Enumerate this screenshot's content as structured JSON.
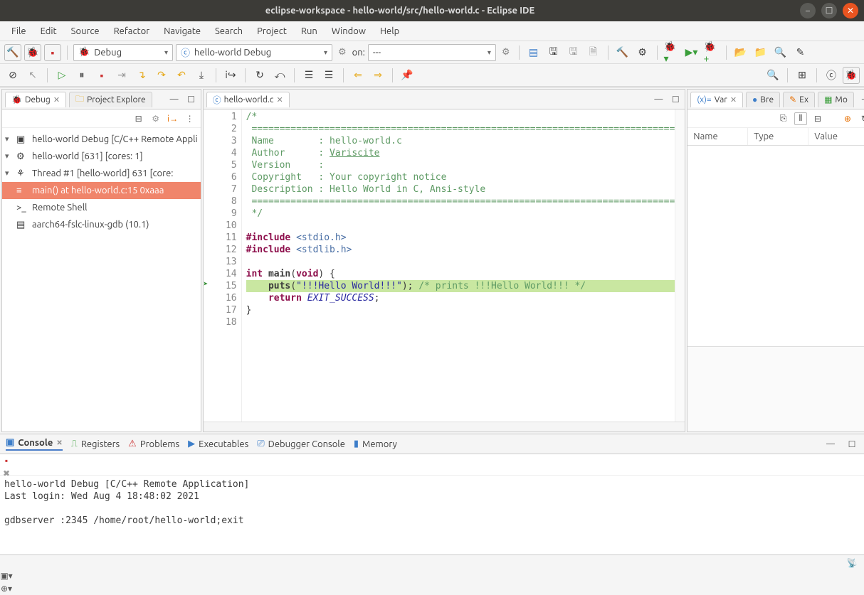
{
  "window": {
    "title": "eclipse-workspace - hello-world/src/hello-world.c - Eclipse IDE"
  },
  "menu": [
    "File",
    "Edit",
    "Source",
    "Refactor",
    "Navigate",
    "Search",
    "Project",
    "Run",
    "Window",
    "Help"
  ],
  "run_config": {
    "mode": "Debug",
    "launch": "hello-world Debug",
    "on_label": "on:",
    "on_value": "---"
  },
  "debug_view": {
    "tab_debug": "Debug",
    "tab_project_explorer": "Project Explore",
    "tree": [
      {
        "indent": 0,
        "twisty": "▾",
        "icon": "launch-icon",
        "label": "hello-world Debug [C/C++ Remote Appli"
      },
      {
        "indent": 1,
        "twisty": "▾",
        "icon": "process-icon",
        "label": "hello-world [631] [cores: 1]"
      },
      {
        "indent": 2,
        "twisty": "▾",
        "icon": "thread-icon",
        "label": "Thread #1 [hello-world] 631 [core:"
      },
      {
        "indent": 3,
        "twisty": "",
        "icon": "stackframe-icon",
        "label": "main() at hello-world.c:15 0xaaa",
        "selected": true
      },
      {
        "indent": 1,
        "twisty": "",
        "icon": "shell-icon",
        "label": "Remote Shell"
      },
      {
        "indent": 1,
        "twisty": "",
        "icon": "gdb-icon",
        "label": "aarch64-fslc-linux-gdb (10.1)"
      }
    ]
  },
  "editor": {
    "tab_label": "hello-world.c",
    "current_line": 15,
    "lines": [
      {
        "n": 1,
        "html": "<span class='tok-comment'>/*</span>"
      },
      {
        "n": 2,
        "html": "<span class='tok-comment'> ============================================================================</span>"
      },
      {
        "n": 3,
        "html": "<span class='tok-comment'> Name        : hello-world.c</span>"
      },
      {
        "n": 4,
        "html": "<span class='tok-comment'> Author      : </span><span class='tok-link'>Variscite</span>"
      },
      {
        "n": 5,
        "html": "<span class='tok-comment'> Version     :</span>"
      },
      {
        "n": 6,
        "html": "<span class='tok-comment'> Copyright   : Your copyright notice</span>"
      },
      {
        "n": 7,
        "html": "<span class='tok-comment'> Description : Hello World in C, Ansi-style</span>"
      },
      {
        "n": 8,
        "html": "<span class='tok-comment'> ============================================================================</span>"
      },
      {
        "n": 9,
        "html": "<span class='tok-comment'> */</span>"
      },
      {
        "n": 10,
        "html": ""
      },
      {
        "n": 11,
        "html": "<span class='tok-inc'>#include</span> <span class='tok-header'>&lt;stdio.h&gt;</span>"
      },
      {
        "n": 12,
        "html": "<span class='tok-inc'>#include</span> <span class='tok-header'>&lt;stdlib.h&gt;</span>"
      },
      {
        "n": 13,
        "html": ""
      },
      {
        "n": 14,
        "html": "<span class='tok-type'>int</span> <b>main</b>(<span class='tok-type'>void</span>) {"
      },
      {
        "n": 15,
        "html": "    <b>puts</b>(<span class='tok-str'>\"!!!Hello World!!!\"</span>); <span class='tok-comment'>/* prints !!!Hello World!!! */</span>"
      },
      {
        "n": 16,
        "html": "    <span class='tok-key'>return</span> <span class='tok-macro'>EXIT_SUCCESS</span>;"
      },
      {
        "n": 17,
        "html": "}"
      },
      {
        "n": 18,
        "html": ""
      }
    ]
  },
  "vars_view": {
    "tab_var": "Var",
    "tab_bre": "Bre",
    "tab_ex": "Ex",
    "tab_mo": "Mo",
    "col_name": "Name",
    "col_type": "Type",
    "col_value": "Value"
  },
  "bottom_tabs": {
    "console": "Console",
    "registers": "Registers",
    "problems": "Problems",
    "executables": "Executables",
    "debugger_console": "Debugger Console",
    "memory": "Memory"
  },
  "console": {
    "header": "hello-world Debug [C/C++ Remote Application]",
    "lines": [
      "Last login: Wed Aug  4 18:48:02 2021",
      "",
      "gdbserver  :2345 /home/root/hello-world;exit",
      ""
    ]
  }
}
